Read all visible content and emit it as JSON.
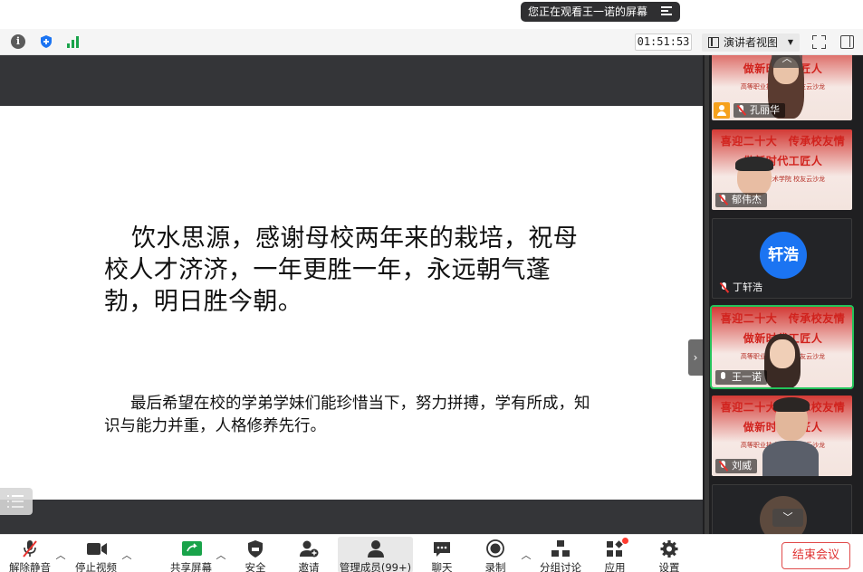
{
  "top_banner": {
    "viewing_label": "您正在观看王一诺的屏幕"
  },
  "toolbar": {
    "timer": "01:51:53",
    "view_mode": "演讲者视图",
    "signal_color": "#19a34a"
  },
  "slide": {
    "paragraph_large": "饮水思源，感谢母校两年来的栽培，祝母校人才济济，一年更胜一年，永远朝气蓬勃，明日胜今朝。",
    "paragraph_small": "最后希望在校的学弟学妹们能珍惜当下，努力拼搏，学有所成，知识与能力并重，人格修养先行。"
  },
  "gallery": {
    "banner_line1": "喜迎二十大　传承校友情",
    "banner_line2": "做新时代工匠人",
    "banner_line3": "高等职业技术学院 校友云沙龙",
    "participants": [
      {
        "name": "孔丽华",
        "host": true,
        "video": true
      },
      {
        "name": "郁伟杰",
        "host": false,
        "video": true
      },
      {
        "name": "丁轩浩",
        "host": false,
        "video": false,
        "avatar_text": "轩浩",
        "avatar_color": "#1b74f2"
      },
      {
        "name": "王一诺",
        "host": false,
        "video": true,
        "active": true
      },
      {
        "name": "刘威",
        "host": false,
        "video": true
      }
    ],
    "active_border_color": "#23c35a"
  },
  "bottom_bar": {
    "unmute": "解除静音",
    "stop_video": "停止视频",
    "share_screen": "共享屏幕",
    "security": "安全",
    "invite": "邀请",
    "manage_members": "管理成员(99+)",
    "chat": "聊天",
    "record": "录制",
    "breakout": "分组讨论",
    "apps": "应用",
    "settings": "设置",
    "end_meeting": "结束会议",
    "end_color": "#e03232"
  }
}
